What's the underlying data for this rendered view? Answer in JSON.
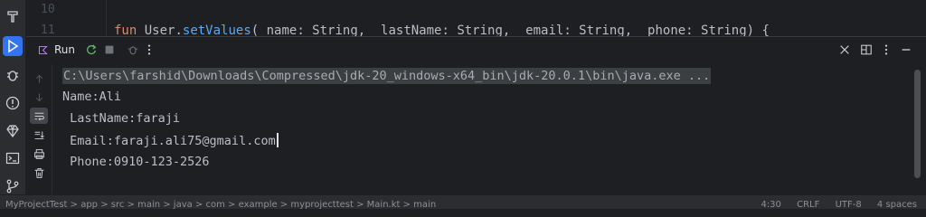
{
  "editor": {
    "lines": [
      {
        "number": "10",
        "code": ""
      },
      {
        "number": "11",
        "keyword": "fun",
        "receiver": "User.",
        "fn": "setValues",
        "rest": "( name: String,  lastName: String,  email: String,  phone: String) {"
      }
    ]
  },
  "run_panel": {
    "tab_label": "Run",
    "console_lines": [
      "C:\\Users\\farshid\\Downloads\\Compressed\\jdk-20_windows-x64_bin\\jdk-20.0.1\\bin\\java.exe ...",
      "Name:Ali",
      " LastName:faraji",
      " Email:faraji.ali75@gmail.com",
      " Phone:0910-123-2526"
    ]
  },
  "status_bar": {
    "breadcrumbs": "MyProjectTest  >  app  >  src  >  main  >  java  >  com  >  example  >  myprojecttest  >  Main.kt  >  main",
    "position": "4:30",
    "line_ending": "CRLF",
    "encoding": "UTF-8",
    "indent": "4 spaces"
  },
  "colors": {
    "accent": "#3574f0",
    "background": "#1e1f22",
    "panel": "#2b2d30"
  }
}
